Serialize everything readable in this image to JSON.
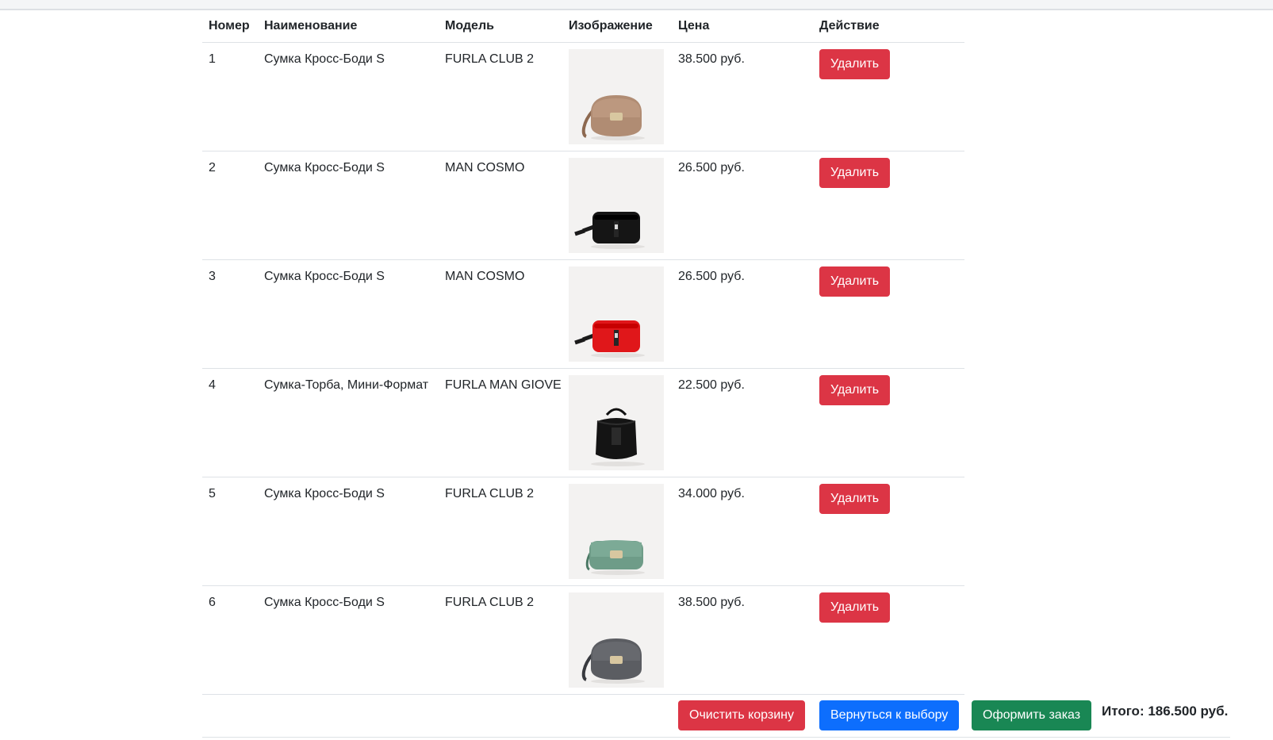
{
  "table": {
    "headers": {
      "number": "Номер",
      "name": "Наименование",
      "model": "Модель",
      "image": "Изображение",
      "price": "Цена",
      "action": "Действие"
    },
    "rows": [
      {
        "number": "1",
        "name": "Сумка Кросс-Боди S",
        "model": "FURLA CLUB 2",
        "price": "38.500 руб.",
        "action": "Удалить",
        "bag_color": "#b08c73",
        "bag_type": "saddle"
      },
      {
        "number": "2",
        "name": "Сумка Кросс-Боди S",
        "model": "MAN COSMO",
        "price": "26.500 руб.",
        "action": "Удалить",
        "bag_color": "#151515",
        "bag_type": "box"
      },
      {
        "number": "3",
        "name": "Сумка Кросс-Боди S",
        "model": "MAN COSMO",
        "price": "26.500 руб.",
        "action": "Удалить",
        "bag_color": "#e0171a",
        "bag_type": "box"
      },
      {
        "number": "4",
        "name": "Сумка-Торба, Мини-Формат",
        "model": "FURLA MAN GIOVE",
        "price": "22.500 руб.",
        "action": "Удалить",
        "bag_color": "#141414",
        "bag_type": "bucket"
      },
      {
        "number": "5",
        "name": "Сумка Кросс-Боди S",
        "model": "FURLA CLUB 2",
        "price": "34.000 руб.",
        "action": "Удалить",
        "bag_color": "#6e9c88",
        "bag_type": "flap"
      },
      {
        "number": "6",
        "name": "Сумка Кросс-Боди S",
        "model": "FURLA CLUB 2",
        "price": "38.500 руб.",
        "action": "Удалить",
        "bag_color": "#5b5d62",
        "bag_type": "saddle"
      }
    ]
  },
  "footer": {
    "clear_label": "Очистить корзину",
    "back_label": "Вернуться к выбору",
    "order_label": "Оформить заказ",
    "total_text": "Итого: 186.500 руб."
  },
  "colors": {
    "danger": "#dc3545",
    "primary": "#0d6efd",
    "success": "#198754"
  }
}
